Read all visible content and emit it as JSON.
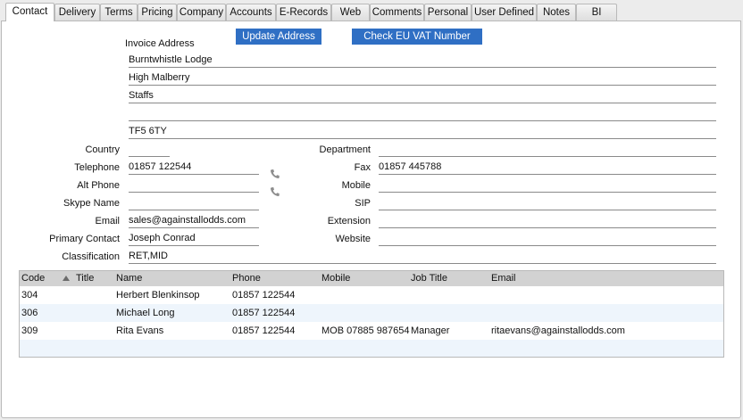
{
  "tabs": [
    {
      "label": "Contact",
      "active": true
    },
    {
      "label": "Delivery"
    },
    {
      "label": "Terms"
    },
    {
      "label": "Pricing"
    },
    {
      "label": "Company"
    },
    {
      "label": "Accounts"
    },
    {
      "label": "E-Records"
    },
    {
      "label": "Web"
    },
    {
      "label": "Comments"
    },
    {
      "label": "Personal"
    },
    {
      "label": "User Defined"
    },
    {
      "label": "Notes"
    },
    {
      "label": "BI"
    }
  ],
  "buttons": {
    "update_address": "Update Address",
    "check_vat": "Check EU VAT Number"
  },
  "invoice_address": {
    "label": "Invoice Address",
    "lines": [
      "Burntwhistle Lodge",
      "High Malberry",
      "Staffs",
      "",
      "TF5 6TY"
    ]
  },
  "left_fields": {
    "country": {
      "label": "Country",
      "value": ""
    },
    "telephone": {
      "label": "Telephone",
      "value": "01857 122544"
    },
    "alt_phone": {
      "label": "Alt Phone",
      "value": ""
    },
    "skype": {
      "label": "Skype Name",
      "value": ""
    },
    "email": {
      "label": "Email",
      "value": "sales@againstallodds.com"
    },
    "primary_contact": {
      "label": "Primary Contact",
      "value": "Joseph Conrad"
    },
    "classification": {
      "label": "Classification",
      "value": "RET,MID"
    }
  },
  "right_fields": {
    "department": {
      "label": "Department",
      "value": ""
    },
    "fax": {
      "label": "Fax",
      "value": "01857 445788"
    },
    "mobile": {
      "label": "Mobile",
      "value": ""
    },
    "sip": {
      "label": "SIP",
      "value": ""
    },
    "extension": {
      "label": "Extension",
      "value": ""
    },
    "website": {
      "label": "Website",
      "value": ""
    }
  },
  "contacts_table": {
    "headers": {
      "code": "Code",
      "title": "Title",
      "name": "Name",
      "phone": "Phone",
      "mobile": "Mobile",
      "job_title": "Job Title",
      "email": "Email"
    },
    "rows": [
      {
        "code": "304",
        "title": "",
        "name": "Herbert Blenkinsop",
        "phone": "01857 122544",
        "mobile": "",
        "job_title": "",
        "email": ""
      },
      {
        "code": "306",
        "title": "",
        "name": "Michael Long",
        "phone": "01857 122544",
        "mobile": "",
        "job_title": "",
        "email": ""
      },
      {
        "code": "309",
        "title": "",
        "name": "Rita Evans",
        "phone": "01857 122544",
        "mobile": "MOB 07885 987654",
        "job_title": "Manager",
        "email": "ritaevans@againstallodds.com"
      }
    ]
  },
  "icons": {
    "phone_telephone": "phone-icon",
    "phone_alt": "phone-icon",
    "sort": "sort-ascending-icon"
  },
  "colors": {
    "button_bg": "#2f6fc4",
    "header_bg": "#d2d2d2",
    "row_alt": "#eef5fc"
  }
}
